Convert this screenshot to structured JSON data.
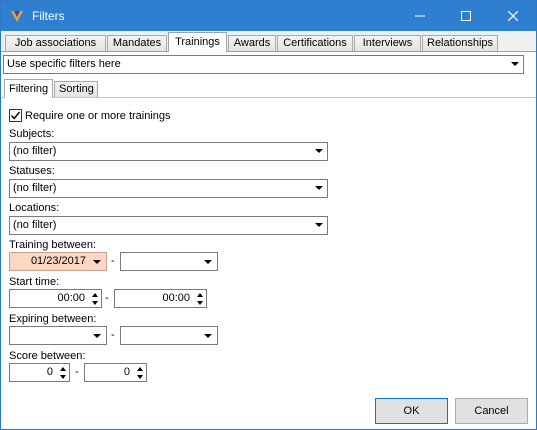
{
  "window": {
    "title": "Filters"
  },
  "tabs": [
    "Job associations",
    "Mandates",
    "Trainings",
    "Awards",
    "Certifications",
    "Interviews",
    "Relationships"
  ],
  "active_tab": "Trainings",
  "filter_mode": {
    "value": "Use specific filters here"
  },
  "subtabs": [
    "Filtering",
    "Sorting"
  ],
  "active_subtab": "Filtering",
  "filters": {
    "require": {
      "label": "Require one or more trainings",
      "checked": true
    },
    "subjects": {
      "label": "Subjects:",
      "value": "(no filter)"
    },
    "statuses": {
      "label": "Statuses:",
      "value": "(no filter)"
    },
    "locations": {
      "label": "Locations:",
      "value": "(no filter)"
    },
    "training_between": {
      "label": "Training between:",
      "from": "01/23/2017",
      "to": ""
    },
    "start_time": {
      "label": "Start time:",
      "from": "00:00",
      "to": "00:00"
    },
    "expiring_between": {
      "label": "Expiring between:",
      "from": "",
      "to": ""
    },
    "score_between": {
      "label": "Score between:",
      "from": "0",
      "to": "0"
    },
    "separator": "-"
  },
  "buttons": {
    "ok": "OK",
    "cancel": "Cancel"
  }
}
